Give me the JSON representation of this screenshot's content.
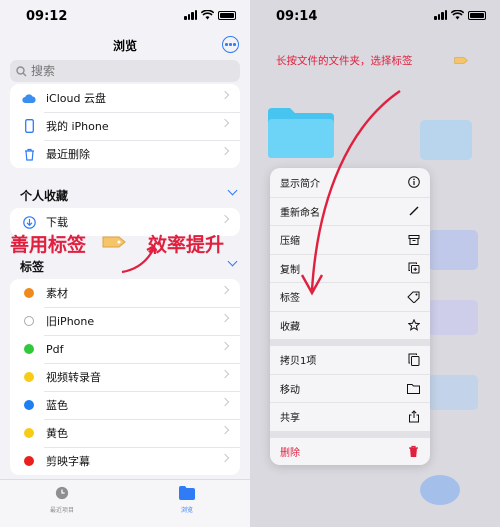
{
  "left": {
    "time": "09:12",
    "title": "浏览",
    "search_placeholder": "搜索",
    "locations": [
      {
        "label": "iCloud 云盘",
        "icon": "cloud-icon"
      },
      {
        "label": "我的 iPhone",
        "icon": "phone-icon"
      },
      {
        "label": "最近删除",
        "icon": "trash-icon"
      }
    ],
    "favorites_header": "个人收藏",
    "favorites": [
      {
        "label": "下载",
        "icon": "download-icon"
      }
    ],
    "tags_header": "标签",
    "tags": [
      {
        "label": "素材",
        "color": "#f08a1c"
      },
      {
        "label": "旧iPhone",
        "color": "#ffffff"
      },
      {
        "label": "Pdf",
        "color": "#2fc93a"
      },
      {
        "label": "视频转录音",
        "color": "#f7cc17"
      },
      {
        "label": "蓝色",
        "color": "#1d7ff0"
      },
      {
        "label": "黄色",
        "color": "#f7cc17"
      },
      {
        "label": "剪映字幕",
        "color": "#e8211e"
      }
    ],
    "tabs": {
      "recent": "最近项目",
      "browse": "浏览"
    },
    "annotation_left": "善用标签",
    "annotation_right": "效率提升"
  },
  "right": {
    "time": "09:14",
    "hint": "长按文件的文件夹，选择标签",
    "menu": [
      {
        "label": "显示简介",
        "icon": "info-icon"
      },
      {
        "label": "重新命名",
        "icon": "pencil-icon"
      },
      {
        "label": "压缩",
        "icon": "archive-icon"
      },
      {
        "label": "复制",
        "icon": "duplicate-icon"
      },
      {
        "label": "标签",
        "icon": "tag-icon"
      },
      {
        "label": "收藏",
        "icon": "star-icon"
      }
    ],
    "menu2": [
      {
        "label": "拷贝1项",
        "icon": "copy-icon"
      },
      {
        "label": "移动",
        "icon": "folder-icon"
      },
      {
        "label": "共享",
        "icon": "share-icon"
      }
    ],
    "delete_label": "删除",
    "colors": {
      "accent": "#2f7cf6",
      "danger": "#e0203f"
    }
  }
}
